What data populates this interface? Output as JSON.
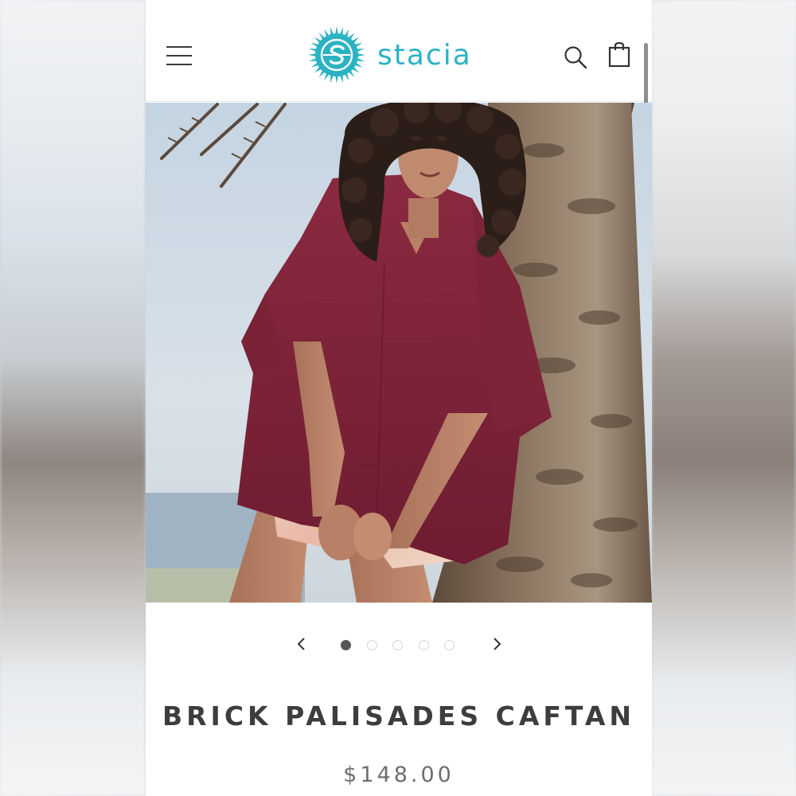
{
  "header": {
    "brand_name": "stacia",
    "menu_icon": "hamburger-menu-icon",
    "search_icon": "search-icon",
    "cart_icon": "shopping-bag-icon",
    "brand_color": "#2bb3c4"
  },
  "gallery": {
    "prev_icon": "chevron-left-icon",
    "next_icon": "chevron-right-icon",
    "slide_count": 5,
    "active_slide": 1
  },
  "product": {
    "title": "BRICK PALISADES CAFTAN",
    "price": "$148.00",
    "garment_color": "#7e2238"
  }
}
